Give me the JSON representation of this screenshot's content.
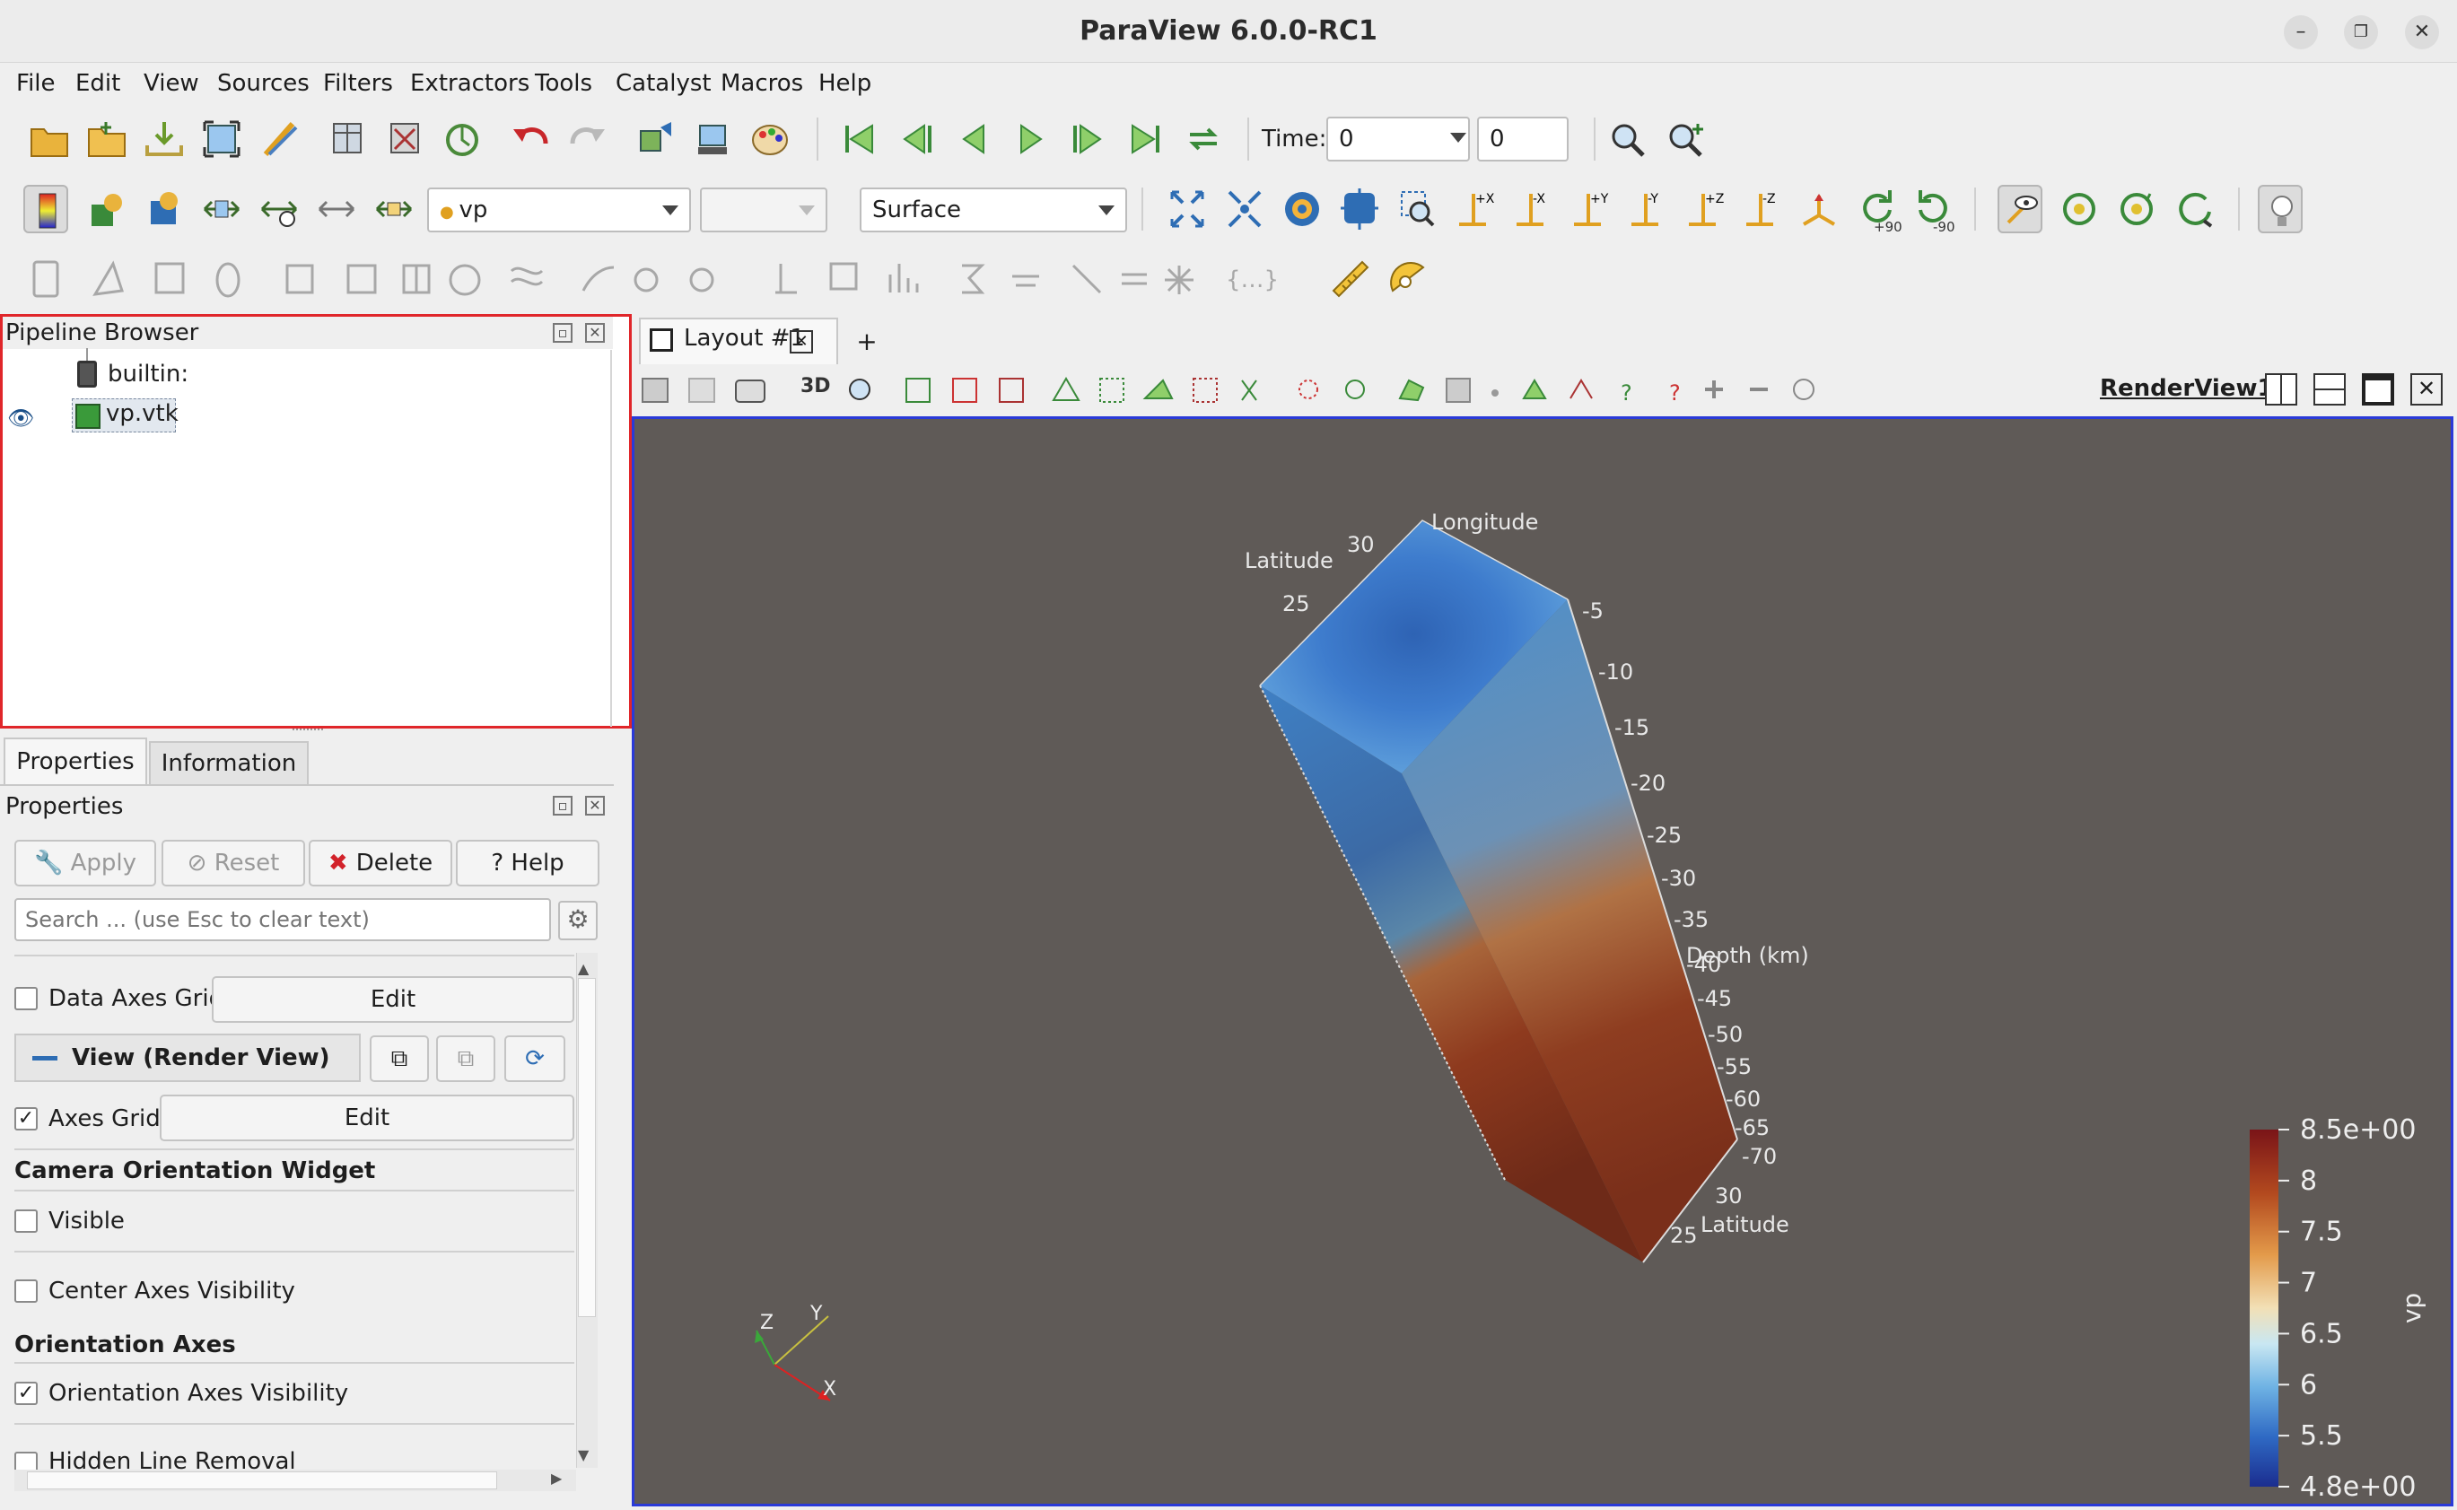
{
  "window": {
    "title": "ParaView 6.0.0-RC1"
  },
  "menu": [
    "File",
    "Edit",
    "View",
    "Sources",
    "Filters",
    "Extractors",
    "Tools",
    "Catalyst",
    "Macros",
    "Help"
  ],
  "toolbar": {
    "time_label": "Time:",
    "time_value": "0",
    "timestep_value": "0",
    "array_combo": "vp",
    "representation_combo": "Surface",
    "rotate_plus": "+90",
    "rotate_minus": "-90"
  },
  "pipeline": {
    "title": "Pipeline Browser",
    "items": [
      {
        "label": "builtin:"
      },
      {
        "label": "vp.vtk"
      }
    ]
  },
  "tabs": {
    "properties": "Properties",
    "information": "Information"
  },
  "properties": {
    "header": "Properties",
    "apply": "Apply",
    "reset": "Reset",
    "delete": "Delete",
    "help": "Help",
    "search_placeholder": "Search ... (use Esc to clear text)",
    "data_axes_grid": "Data Axes Grid",
    "edit": "Edit",
    "view_section": "View (Render View)",
    "axes_grid": "Axes Grid",
    "axes_grid_checked": true,
    "camera_widget": "Camera Orientation Widget",
    "visible": "Visible",
    "center_axes": "Center Axes Visibility",
    "orientation_axes": "Orientation Axes",
    "orientation_axes_visibility": "Orientation Axes Visibility",
    "orientation_axes_checked": true,
    "hidden_line_removal": "Hidden Line Removal"
  },
  "layout": {
    "tab": "Layout #1",
    "add": "+",
    "view_label": "RenderView1",
    "mode_3d": "3D"
  },
  "render": {
    "background": "#5f5a57",
    "axes": {
      "longitude": "Longitude",
      "latitude_top": "Latitude",
      "latitude_bottom": "Latitude",
      "depth": "Depth (km)",
      "lat_ticks_top": [
        "30",
        "25"
      ],
      "lat_ticks_bottom": [
        "30",
        "25"
      ],
      "depth_ticks": [
        "-5",
        "-10",
        "-15",
        "-20",
        "-25",
        "-30",
        "-35",
        "-40",
        "-45",
        "-50",
        "-55",
        "-60",
        "-65",
        "-70"
      ]
    },
    "orientation": {
      "x": "X",
      "y": "Y",
      "z": "Z"
    },
    "colorbar": {
      "title": "vp",
      "labels": [
        "8.5e+00",
        "8",
        "7.5",
        "7",
        "6.5",
        "6",
        "5.5",
        "4.8e+00"
      ],
      "min": 4.8,
      "max": 8.5,
      "colors": [
        "#7a1418",
        "#b34a1f",
        "#e39a4a",
        "#f2e0b6",
        "#c9e7f2",
        "#6fb3e4",
        "#2f6ac4",
        "#1b2d8f"
      ]
    }
  }
}
